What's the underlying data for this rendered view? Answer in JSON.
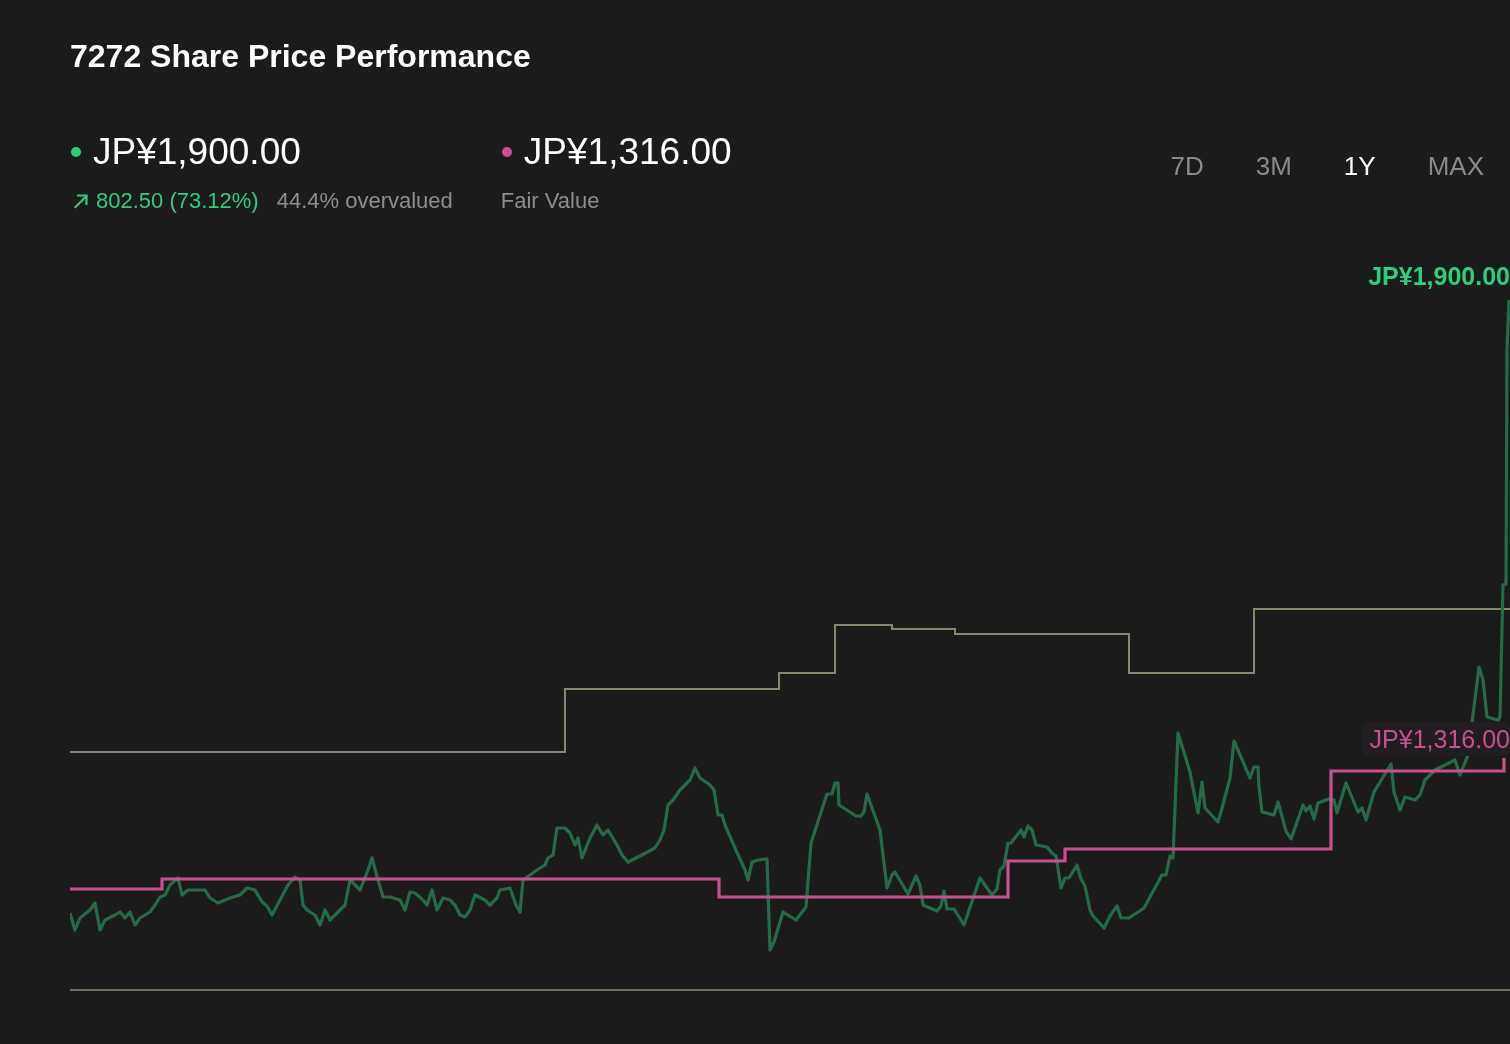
{
  "title": "7272 Share Price Performance",
  "summary": [
    {
      "kind": "price",
      "value": "JP¥1,900.00",
      "color": "#2fce7c",
      "change": "802.50 (73.12%)",
      "note": "44.4% overvalued"
    },
    {
      "kind": "fair_value",
      "value": "JP¥1,316.00",
      "color": "#c9508f",
      "caption": "Fair Value"
    }
  ],
  "periods": [
    {
      "label": "7D",
      "selected": false
    },
    {
      "label": "3M",
      "selected": false
    },
    {
      "label": "1Y",
      "selected": true
    },
    {
      "label": "MAX",
      "selected": false
    }
  ],
  "chart": {
    "price_label": "JP¥1,900.00",
    "fair_value_label": "JP¥1,316.00"
  }
}
